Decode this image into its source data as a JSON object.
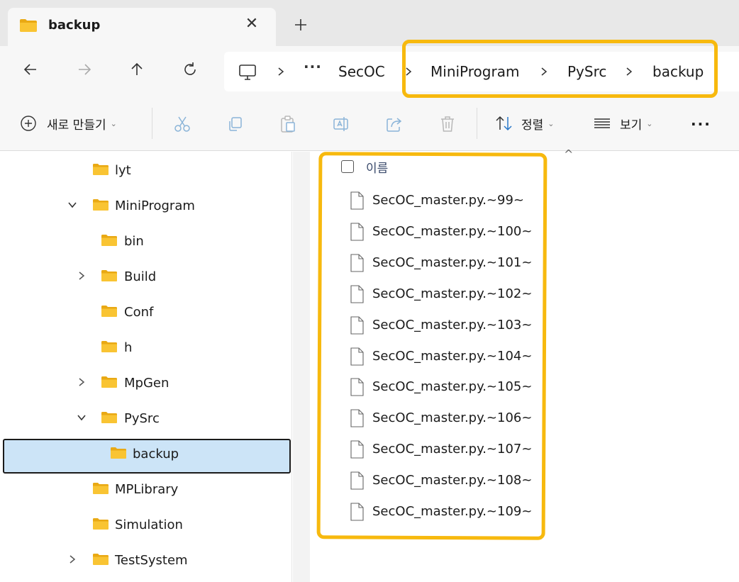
{
  "window": {
    "tab_title": "backup",
    "tab_close_glyph": "✕",
    "new_tab_icon": "plus-icon"
  },
  "nav": {
    "back_icon": "arrow-left-icon",
    "forward_icon": "arrow-right-icon",
    "up_icon": "arrow-up-icon",
    "refresh_icon": "refresh-icon"
  },
  "address": {
    "root_icon": "computer-icon",
    "more": "···",
    "crumbs": [
      "SecOC",
      "MiniProgram",
      "PySrc",
      "backup"
    ]
  },
  "toolbar": {
    "new_label": "새로 만들기",
    "sort_label": "정렬",
    "view_label": "보기",
    "caret": "⌄",
    "more": "···",
    "icons": [
      "cut-icon",
      "copy-icon",
      "paste-icon",
      "rename-icon",
      "share-icon",
      "delete-icon"
    ]
  },
  "tree": [
    {
      "label": "lyt",
      "expanded": null
    },
    {
      "label": "MiniProgram",
      "expanded": true
    },
    {
      "label": "bin",
      "expanded": null
    },
    {
      "label": "Build",
      "expanded": false
    },
    {
      "label": "Conf",
      "expanded": null
    },
    {
      "label": "h",
      "expanded": null
    },
    {
      "label": "MpGen",
      "expanded": false
    },
    {
      "label": "PySrc",
      "expanded": true
    },
    {
      "label": "backup",
      "expanded": null,
      "selected": true
    },
    {
      "label": "MPLibrary",
      "expanded": null
    },
    {
      "label": "Simulation",
      "expanded": null
    },
    {
      "label": "TestSystem",
      "expanded": false
    }
  ],
  "list": {
    "column_name": "이름",
    "sort_caret": "^",
    "files": [
      "SecOC_master.py.~99~",
      "SecOC_master.py.~100~",
      "SecOC_master.py.~101~",
      "SecOC_master.py.~102~",
      "SecOC_master.py.~103~",
      "SecOC_master.py.~104~",
      "SecOC_master.py.~105~",
      "SecOC_master.py.~106~",
      "SecOC_master.py.~107~",
      "SecOC_master.py.~108~",
      "SecOC_master.py.~109~"
    ]
  },
  "colors": {
    "highlight": "#f7b90e",
    "selection": "#cce4f7",
    "folder": "#f9c433",
    "folder_dark": "#e9a914"
  }
}
